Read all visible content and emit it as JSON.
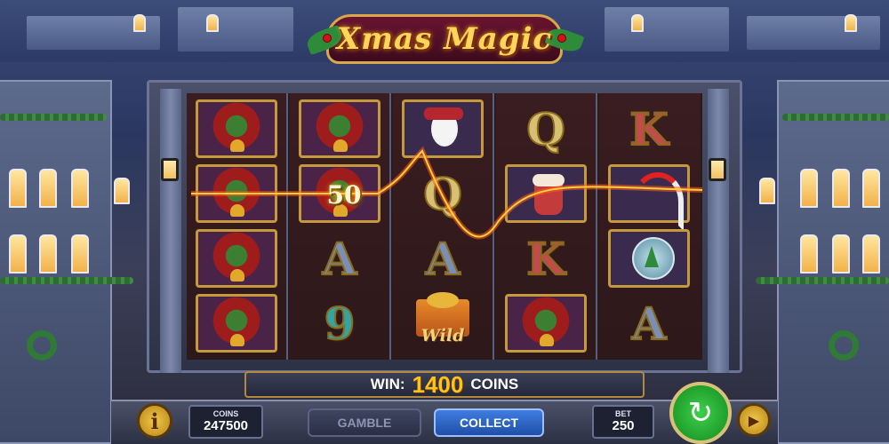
{
  "game": {
    "logo_title": "Xmas Magic"
  },
  "reels": [
    [
      "bells-bow",
      "bells-bow",
      "bells-bow",
      "bells-bow"
    ],
    [
      "bells-bow",
      "bells-bow",
      "A",
      "9"
    ],
    [
      "snowman-stocking",
      "Q",
      "A",
      "wild-gift"
    ],
    [
      "Q",
      "hot-cocoa-mug",
      "K",
      "bells-bow"
    ],
    [
      "K",
      "candy-canes",
      "snow-globe",
      "A"
    ]
  ],
  "wild_label": "Wild",
  "line_win": "50",
  "win_bar": {
    "label": "WIN:",
    "amount": "1400",
    "unit": "COINS"
  },
  "coins": {
    "label": "COINS",
    "value": "247500"
  },
  "bet": {
    "label": "BET",
    "value": "250"
  },
  "buttons": {
    "info": "i",
    "gamble": "GAMBLE",
    "collect": "COLLECT",
    "spin_icon": "refresh-arrows-icon",
    "autoplay_icon": "play-circle-icon"
  },
  "colors": {
    "win_amount": "#ffc21a",
    "collect_button": "#3f7de0",
    "spin_button": "#3ed04a",
    "payline": "#ffcf3a"
  }
}
